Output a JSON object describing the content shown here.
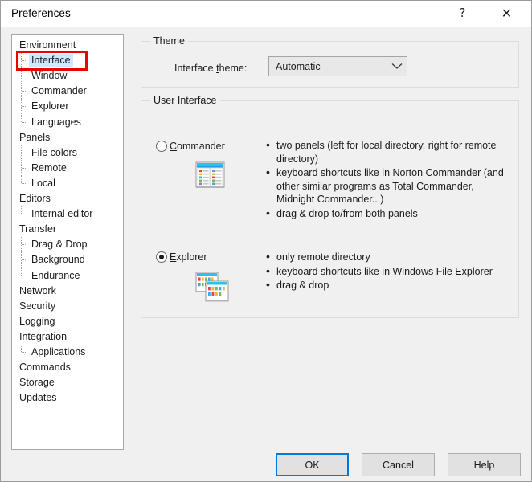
{
  "window": {
    "title": "Preferences",
    "help_glyph": "?",
    "close_glyph": "✕"
  },
  "sidebar": {
    "items": [
      {
        "label": "Environment",
        "level": 0,
        "selected": false,
        "last": false
      },
      {
        "label": "Interface",
        "level": 1,
        "selected": true,
        "last": false
      },
      {
        "label": "Window",
        "level": 1,
        "selected": false,
        "last": false
      },
      {
        "label": "Commander",
        "level": 1,
        "selected": false,
        "last": false
      },
      {
        "label": "Explorer",
        "level": 1,
        "selected": false,
        "last": false
      },
      {
        "label": "Languages",
        "level": 1,
        "selected": false,
        "last": true
      },
      {
        "label": "Panels",
        "level": 0,
        "selected": false,
        "last": false
      },
      {
        "label": "File colors",
        "level": 1,
        "selected": false,
        "last": false
      },
      {
        "label": "Remote",
        "level": 1,
        "selected": false,
        "last": false
      },
      {
        "label": "Local",
        "level": 1,
        "selected": false,
        "last": true
      },
      {
        "label": "Editors",
        "level": 0,
        "selected": false,
        "last": false
      },
      {
        "label": "Internal editor",
        "level": 1,
        "selected": false,
        "last": true
      },
      {
        "label": "Transfer",
        "level": 0,
        "selected": false,
        "last": false
      },
      {
        "label": "Drag & Drop",
        "level": 1,
        "selected": false,
        "last": false
      },
      {
        "label": "Background",
        "level": 1,
        "selected": false,
        "last": false
      },
      {
        "label": "Endurance",
        "level": 1,
        "selected": false,
        "last": true
      },
      {
        "label": "Network",
        "level": 0,
        "selected": false,
        "last": false
      },
      {
        "label": "Security",
        "level": 0,
        "selected": false,
        "last": false
      },
      {
        "label": "Logging",
        "level": 0,
        "selected": false,
        "last": false
      },
      {
        "label": "Integration",
        "level": 0,
        "selected": false,
        "last": false
      },
      {
        "label": "Applications",
        "level": 1,
        "selected": false,
        "last": true
      },
      {
        "label": "Commands",
        "level": 0,
        "selected": false,
        "last": false
      },
      {
        "label": "Storage",
        "level": 0,
        "selected": false,
        "last": false
      },
      {
        "label": "Updates",
        "level": 0,
        "selected": false,
        "last": false
      }
    ],
    "highlight_color": "#ee0000",
    "selection_color": "#cde8ff"
  },
  "theme_group": {
    "title": "Theme",
    "label": "Interface theme:",
    "label_pre": "Interface ",
    "label_accel": "t",
    "label_post": "heme:",
    "selected_value": "Automatic",
    "options": [
      "Automatic"
    ]
  },
  "ui_group": {
    "title": "User Interface",
    "options": [
      {
        "id": "commander",
        "label": "Commander",
        "label_accel": "C",
        "label_rest": "ommander",
        "checked": false,
        "icon": "two-panel-commander-icon",
        "bullets": [
          "two panels (left for local directory, right for remote directory)",
          "keyboard shortcuts like in Norton Commander (and other similar programs as Total Commander, Midnight Commander...)",
          "drag & drop to/from both panels"
        ]
      },
      {
        "id": "explorer",
        "label": "Explorer",
        "label_accel": "E",
        "label_rest": "xplorer",
        "checked": true,
        "icon": "explorer-windows-icon",
        "bullets": [
          "only remote directory",
          "keyboard shortcuts like in Windows File Explorer",
          "drag & drop"
        ]
      }
    ]
  },
  "footer": {
    "ok_label": "OK",
    "cancel_label": "Cancel",
    "help_label": "Help",
    "default_button_color": "#0078d7"
  }
}
